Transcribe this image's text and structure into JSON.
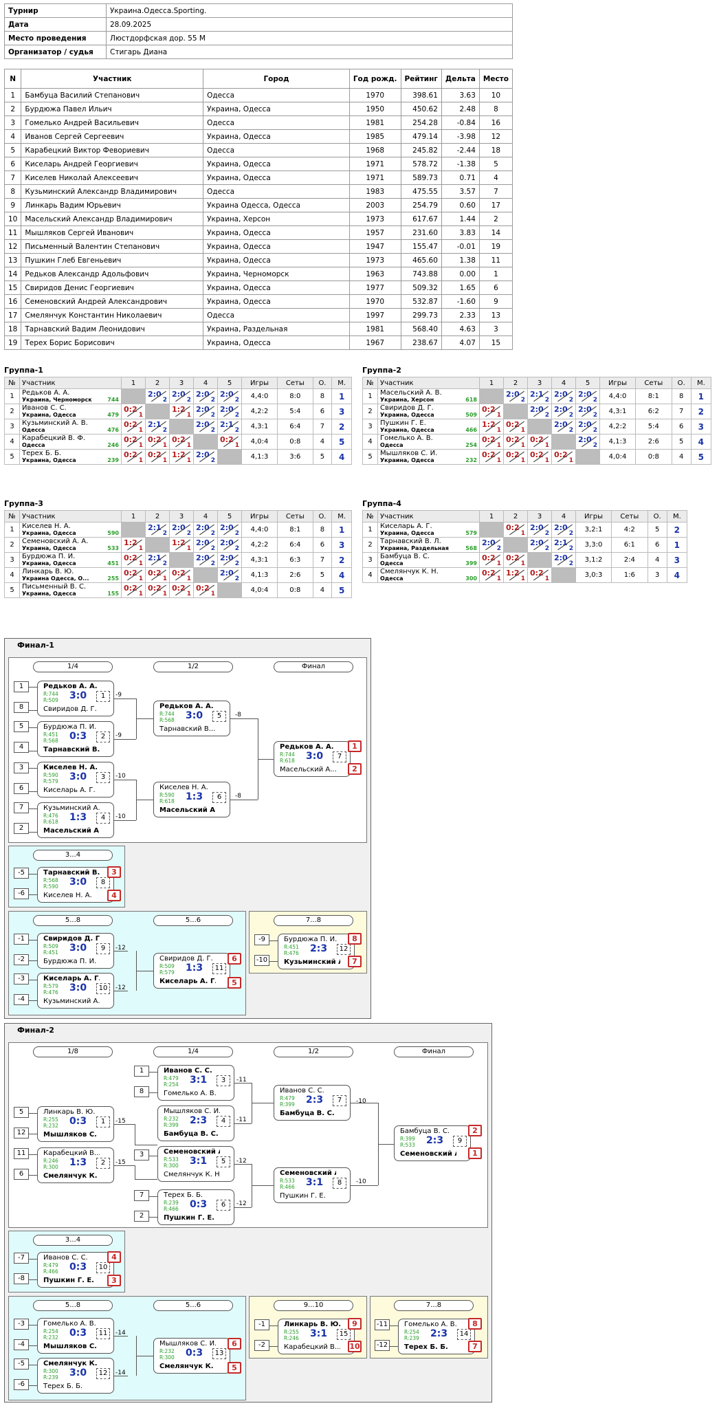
{
  "info": [
    {
      "k": "Турнир",
      "v": "Украина.Одесса.Sporting."
    },
    {
      "k": "Дата",
      "v": "28.09.2025"
    },
    {
      "k": "Место проведения",
      "v": "Люстдорфская дор. 55 М"
    },
    {
      "k": "Организатор / судья",
      "v": "Стигарь Диана"
    }
  ],
  "participants": {
    "headers": [
      "N",
      "Участник",
      "Город",
      "Год рожд.",
      "Рейтинг",
      "Дельта",
      "Место"
    ],
    "rows": [
      [
        "1",
        "Бамбуца Василий Степанович",
        "Одесса",
        "1970",
        "398.61",
        "3.63",
        "10"
      ],
      [
        "2",
        "Бурдюжа Павел Ильич",
        "Украина, Одесса",
        "1950",
        "450.62",
        "2.48",
        "8"
      ],
      [
        "3",
        "Гомелько Андрей Васильевич",
        "Одесса",
        "1981",
        "254.28",
        "-0.84",
        "16"
      ],
      [
        "4",
        "Иванов Сергей Сергеевич",
        "Украина, Одесса",
        "1985",
        "479.14",
        "-3.98",
        "12"
      ],
      [
        "5",
        "Карабецкий Виктор Февориевич",
        "Одесса",
        "1968",
        "245.82",
        "-2.44",
        "18"
      ],
      [
        "6",
        "Киселарь Андрей Георгиевич",
        "Украина, Одесса",
        "1971",
        "578.72",
        "-1.38",
        "5"
      ],
      [
        "7",
        "Киселев Николай Алексеевич",
        "Украина, Одесса",
        "1971",
        "589.73",
        "0.71",
        "4"
      ],
      [
        "8",
        "Кузьминский Александр Владимирович",
        "Одесса",
        "1983",
        "475.55",
        "3.57",
        "7"
      ],
      [
        "9",
        "Линкарь Вадим Юрьевич",
        "Украина Одесса, Одесса",
        "2003",
        "254.79",
        "0.60",
        "17"
      ],
      [
        "10",
        "Масельский Александр Владимирович",
        "Украина, Херсон",
        "1973",
        "617.67",
        "1.44",
        "2"
      ],
      [
        "11",
        "Мышляков Сергей Иванович",
        "Украина, Одесса",
        "1957",
        "231.60",
        "3.83",
        "14"
      ],
      [
        "12",
        "Письменный Валентин Степанович",
        "Украина, Одесса",
        "1947",
        "155.47",
        "-0.01",
        "19"
      ],
      [
        "13",
        "Пушкин Глеб Евгеньевич",
        "Украина, Одесса",
        "1973",
        "465.60",
        "1.38",
        "11"
      ],
      [
        "14",
        "Редьков Александр Адольфович",
        "Украина, Черноморск",
        "1963",
        "743.88",
        "0.00",
        "1"
      ],
      [
        "15",
        "Свиридов Денис Георгиевич",
        "Украина, Одесса",
        "1977",
        "509.32",
        "1.65",
        "6"
      ],
      [
        "16",
        "Семеновский Андрей Александрович",
        "Украина, Одесса",
        "1970",
        "532.87",
        "-1.60",
        "9"
      ],
      [
        "17",
        "Смелянчук Константин Николаевич",
        "Одесса",
        "1997",
        "299.73",
        "2.33",
        "13"
      ],
      [
        "18",
        "Тарнавский Вадим Леонидович",
        "Украина, Раздельная",
        "1981",
        "568.40",
        "4.63",
        "3"
      ],
      [
        "19",
        "Терех Борис Борисович",
        "Украина, Одесса",
        "1967",
        "238.67",
        "4.07",
        "15"
      ]
    ]
  },
  "groups": [
    {
      "title": "Группа-1",
      "cols": [
        "№",
        "Участник",
        "1",
        "2",
        "3",
        "4",
        "5",
        "Игры",
        "Сеты",
        "О.",
        "М."
      ],
      "rows": [
        {
          "n": "1",
          "name": "Редьков А. А.",
          "city": "Украина, Черноморск",
          "rt": "744",
          "res": [
            "X",
            "2:0/2",
            "2:0/2",
            "2:0/2",
            "2:0/2"
          ],
          "g": "4,4:0",
          "s": "8:0",
          "o": "8",
          "m": "1"
        },
        {
          "n": "2",
          "name": "Иванов С. С.",
          "city": "Украина, Одесса",
          "rt": "479",
          "res": [
            "0:2/1",
            "X",
            "1:2/1",
            "2:0/2",
            "2:0/2"
          ],
          "g": "4,2:2",
          "s": "5:4",
          "o": "6",
          "m": "3"
        },
        {
          "n": "3",
          "name": "Кузьминский А. В.",
          "city": "Одесса",
          "rt": "476",
          "res": [
            "0:2/1",
            "2:1/2",
            "X",
            "2:0/2",
            "2:1/2"
          ],
          "g": "4,3:1",
          "s": "6:4",
          "o": "7",
          "m": "2"
        },
        {
          "n": "4",
          "name": "Карабецкий В. Ф.",
          "city": "Одесса",
          "rt": "246",
          "res": [
            "0:2/1",
            "0:2/1",
            "0:2/1",
            "X",
            "0:2/1"
          ],
          "g": "4,0:4",
          "s": "0:8",
          "o": "4",
          "m": "5"
        },
        {
          "n": "5",
          "name": "Терех Б. Б.",
          "city": "Украина, Одесса",
          "rt": "239",
          "res": [
            "0:2/1",
            "0:2/1",
            "1:2/1",
            "2:0/2",
            "X"
          ],
          "g": "4,1:3",
          "s": "3:6",
          "o": "5",
          "m": "4"
        }
      ]
    },
    {
      "title": "Группа-2",
      "cols": [
        "№",
        "Участник",
        "1",
        "2",
        "3",
        "4",
        "5",
        "Игры",
        "Сеты",
        "О.",
        "М."
      ],
      "rows": [
        {
          "n": "1",
          "name": "Масельский А. В.",
          "city": "Украина, Херсон",
          "rt": "618",
          "res": [
            "X",
            "2:0/2",
            "2:1/2",
            "2:0/2",
            "2:0/2"
          ],
          "g": "4,4:0",
          "s": "8:1",
          "o": "8",
          "m": "1"
        },
        {
          "n": "2",
          "name": "Свиридов Д. Г.",
          "city": "Украина, Одесса",
          "rt": "509",
          "res": [
            "0:2/1",
            "X",
            "2:0/2",
            "2:0/2",
            "2:0/2"
          ],
          "g": "4,3:1",
          "s": "6:2",
          "o": "7",
          "m": "2"
        },
        {
          "n": "3",
          "name": "Пушкин Г. Е.",
          "city": "Украина, Одесса",
          "rt": "466",
          "res": [
            "1:2/1",
            "0:2/1",
            "X",
            "2:0/2",
            "2:0/2"
          ],
          "g": "4,2:2",
          "s": "5:4",
          "o": "6",
          "m": "3"
        },
        {
          "n": "4",
          "name": "Гомелько А. В.",
          "city": "Одесса",
          "rt": "254",
          "res": [
            "0:2/1",
            "0:2/1",
            "0:2/1",
            "X",
            "2:0/2"
          ],
          "g": "4,1:3",
          "s": "2:6",
          "o": "5",
          "m": "4"
        },
        {
          "n": "5",
          "name": "Мышляков С. И.",
          "city": "Украина, Одесса",
          "rt": "232",
          "res": [
            "0:2/1",
            "0:2/1",
            "0:2/1",
            "0:2/1",
            "X"
          ],
          "g": "4,0:4",
          "s": "0:8",
          "o": "4",
          "m": "5"
        }
      ]
    },
    {
      "title": "Группа-3",
      "cols": [
        "№",
        "Участник",
        "1",
        "2",
        "3",
        "4",
        "5",
        "Игры",
        "Сеты",
        "О.",
        "М."
      ],
      "rows": [
        {
          "n": "1",
          "name": "Киселев Н. А.",
          "city": "Украина, Одесса",
          "rt": "590",
          "res": [
            "X",
            "2:1/2",
            "2:0/2",
            "2:0/2",
            "2:0/2"
          ],
          "g": "4,4:0",
          "s": "8:1",
          "o": "8",
          "m": "1"
        },
        {
          "n": "2",
          "name": "Семеновский А. А.",
          "city": "Украина, Одесса",
          "rt": "533",
          "res": [
            "1:2/1",
            "X",
            "1:2/1",
            "2:0/2",
            "2:0/2"
          ],
          "g": "4,2:2",
          "s": "6:4",
          "o": "6",
          "m": "3"
        },
        {
          "n": "3",
          "name": "Бурдюжа П. И.",
          "city": "Украина, Одесса",
          "rt": "451",
          "res": [
            "0:2/1",
            "2:1/2",
            "X",
            "2:0/2",
            "2:0/2"
          ],
          "g": "4,3:1",
          "s": "6:3",
          "o": "7",
          "m": "2"
        },
        {
          "n": "4",
          "name": "Линкарь В. Ю.",
          "city": "Украина Одесса, О...",
          "rt": "255",
          "res": [
            "0:2/1",
            "0:2/1",
            "0:2/1",
            "X",
            "2:0/2"
          ],
          "g": "4,1:3",
          "s": "2:6",
          "o": "5",
          "m": "4"
        },
        {
          "n": "5",
          "name": "Письменный В. С.",
          "city": "Украина, Одесса",
          "rt": "155",
          "res": [
            "0:2/1",
            "0:2/1",
            "0:2/1",
            "0:2/1",
            "X"
          ],
          "g": "4,0:4",
          "s": "0:8",
          "o": "4",
          "m": "5"
        }
      ]
    },
    {
      "title": "Группа-4",
      "cols": [
        "№",
        "Участник",
        "1",
        "2",
        "3",
        "4",
        "Игры",
        "Сеты",
        "О.",
        "М."
      ],
      "rows": [
        {
          "n": "1",
          "name": "Киселарь А. Г.",
          "city": "Украина, Одесса",
          "rt": "579",
          "res": [
            "X",
            "0:2/1",
            "2:0/2",
            "2:0/2"
          ],
          "g": "3,2:1",
          "s": "4:2",
          "o": "5",
          "m": "2"
        },
        {
          "n": "2",
          "name": "Тарнавский В. Л.",
          "city": "Украина, Раздельная",
          "rt": "568",
          "res": [
            "2:0/2",
            "X",
            "2:0/2",
            "2:1/2"
          ],
          "g": "3,3:0",
          "s": "6:1",
          "o": "6",
          "m": "1"
        },
        {
          "n": "3",
          "name": "Бамбуца В. С.",
          "city": "Одесса",
          "rt": "399",
          "res": [
            "0:2/1",
            "0:2/1",
            "X",
            "2:0/2"
          ],
          "g": "3,1:2",
          "s": "2:4",
          "o": "4",
          "m": "3"
        },
        {
          "n": "4",
          "name": "Смелянчук К. Н.",
          "city": "Одесса",
          "rt": "300",
          "res": [
            "0:2/1",
            "1:2/1",
            "0:2/1",
            "X"
          ],
          "g": "3,0:3",
          "s": "1:6",
          "o": "3",
          "m": "4"
        }
      ]
    }
  ],
  "final1": {
    "title": "Финал-1",
    "headers": [
      "1/4",
      "1/2",
      "Финал",
      "3...4",
      "5...8",
      "5...6",
      "7...8"
    ],
    "seeds": [
      "1",
      "8",
      "5",
      "4",
      "3",
      "6",
      "7",
      "2",
      "-5",
      "-6",
      "-1",
      "-2",
      "-3",
      "-4",
      "-9",
      "-10"
    ],
    "matches": [
      {
        "p1": "Редьков А. А.",
        "p2": "Свиридов Д. Г.",
        "r1": "R:744",
        "r2": "R:509",
        "s": "3:0",
        "g": "1",
        "w": 1
      },
      {
        "p1": "Бурдюжа П. И.",
        "p2": "Тарнавский В....",
        "r1": "R:451",
        "r2": "R:568",
        "s": "0:3",
        "g": "2",
        "w": 2
      },
      {
        "p1": "Киселев Н. А.",
        "p2": "Киселарь А. Г.",
        "r1": "R:590",
        "r2": "R:579",
        "s": "3:0",
        "g": "3",
        "w": 1
      },
      {
        "p1": "Кузьминский А....",
        "p2": "Масельский А....",
        "r1": "R:476",
        "r2": "R:618",
        "s": "1:3",
        "g": "4",
        "w": 2
      },
      {
        "p1": "Редьков А. А.",
        "p2": "Тарнавский В....",
        "r1": "R:744",
        "r2": "R:568",
        "s": "3:0",
        "g": "5",
        "w": 1
      },
      {
        "p1": "Киселев Н. А.",
        "p2": "Масельский А....",
        "r1": "R:590",
        "r2": "R:618",
        "s": "1:3",
        "g": "6",
        "w": 2
      },
      {
        "p1": "Редьков А. А.",
        "p2": "Масельский А....",
        "r1": "R:744",
        "r2": "R:618",
        "s": "3:0",
        "g": "7",
        "w": 1
      },
      {
        "p1": "Тарнавский В....",
        "p2": "Киселев Н. А.",
        "r1": "R:568",
        "r2": "R:590",
        "s": "3:0",
        "g": "8",
        "w": 1
      },
      {
        "p1": "Свиридов Д. Г.",
        "p2": "Бурдюжа П. И.",
        "r1": "R:509",
        "r2": "R:451",
        "s": "3:0",
        "g": "9",
        "w": 1
      },
      {
        "p1": "Киселарь А. Г.",
        "p2": "Кузьминский А....",
        "r1": "R:579",
        "r2": "R:476",
        "s": "3:0",
        "g": "10",
        "w": 1
      },
      {
        "p1": "Свиридов Д. Г.",
        "p2": "Киселарь А. Г.",
        "r1": "R:509",
        "r2": "R:579",
        "s": "1:3",
        "g": "11",
        "w": 2
      },
      {
        "p1": "Бурдюжа П. И.",
        "p2": "Кузьминский А....",
        "r1": "R:451",
        "r2": "R:476",
        "s": "2:3",
        "g": "12",
        "w": 2
      }
    ],
    "places": [
      "1",
      "2",
      "3",
      "4",
      "6",
      "5",
      "8",
      "7"
    ],
    "notes": [
      "-9",
      "-9",
      "-10",
      "-10",
      "-8",
      "-8",
      "-12",
      "-12"
    ]
  },
  "final2": {
    "title": "Финал-2",
    "headers": [
      "1/8",
      "1/4",
      "1/2",
      "Финал",
      "3...4",
      "5...8",
      "5...6",
      "9...10",
      "7...8"
    ],
    "seeds": [
      "1",
      "8",
      "5",
      "12",
      "11",
      "6",
      "3",
      "7",
      "2",
      "-7",
      "-8",
      "-3",
      "-4",
      "-5",
      "-6",
      "-1",
      "-2",
      "-11",
      "-12"
    ],
    "matches": [
      {
        "p1": "Иванов С. С.",
        "p2": "Гомелько А. В.",
        "r1": "R:479",
        "r2": "R:254",
        "s": "3:1",
        "g": "3",
        "w": 1
      },
      {
        "p1": "Линкарь В. Ю.",
        "p2": "Мышляков С. И.",
        "r1": "R:255",
        "r2": "R:232",
        "s": "0:3",
        "g": "1",
        "w": 2
      },
      {
        "p1": "Мышляков С. И.",
        "p2": "Бамбуца В. С.",
        "r1": "R:232",
        "r2": "R:399",
        "s": "2:3",
        "g": "4",
        "w": 2
      },
      {
        "p1": "Карабецкий В....",
        "p2": "Смелянчук К. Н.",
        "r1": "R:246",
        "r2": "R:300",
        "s": "1:3",
        "g": "2",
        "w": 2
      },
      {
        "p1": "Семеновский А....",
        "p2": "Смелянчук К. Н.",
        "r1": "R:533",
        "r2": "R:300",
        "s": "3:1",
        "g": "5",
        "w": 1
      },
      {
        "p1": "Терех Б. Б.",
        "p2": "Пушкин Г. Е.",
        "r1": "R:239",
        "r2": "R:466",
        "s": "0:3",
        "g": "6",
        "w": 2
      },
      {
        "p1": "Иванов С. С.",
        "p2": "Бамбуца В. С.",
        "r1": "R:479",
        "r2": "R:399",
        "s": "2:3",
        "g": "7",
        "w": 2
      },
      {
        "p1": "Семеновский А....",
        "p2": "Пушкин Г. Е.",
        "r1": "R:533",
        "r2": "R:466",
        "s": "3:1",
        "g": "8",
        "w": 1
      },
      {
        "p1": "Бамбуца В. С.",
        "p2": "Семеновский А....",
        "r1": "R:399",
        "r2": "R:533",
        "s": "2:3",
        "g": "9",
        "w": 2
      },
      {
        "p1": "Иванов С. С.",
        "p2": "Пушкин Г. Е.",
        "r1": "R:479",
        "r2": "R:466",
        "s": "0:3",
        "g": "10",
        "w": 2
      },
      {
        "p1": "Гомелько А. В.",
        "p2": "Мышляков С. И.",
        "r1": "R:254",
        "r2": "R:232",
        "s": "0:3",
        "g": "11",
        "w": 2
      },
      {
        "p1": "Смелянчук К. Н.",
        "p2": "Терех Б. Б.",
        "r1": "R:300",
        "r2": "R:239",
        "s": "3:0",
        "g": "12",
        "w": 1
      },
      {
        "p1": "Мышляков С. И.",
        "p2": "Смелянчук К. Н.",
        "r1": "R:232",
        "r2": "R:300",
        "s": "0:3",
        "g": "13",
        "w": 2
      },
      {
        "p1": "Линкарь В. Ю.",
        "p2": "Карабецкий В....",
        "r1": "R:255",
        "r2": "R:246",
        "s": "3:1",
        "g": "15",
        "w": 1
      },
      {
        "p1": "Гомелько А. В.",
        "p2": "Терех Б. Б.",
        "r1": "R:254",
        "r2": "R:239",
        "s": "2:3",
        "g": "14",
        "w": 2
      }
    ],
    "places": [
      "2",
      "1",
      "4",
      "3",
      "6",
      "5",
      "9",
      "10",
      "8",
      "7"
    ],
    "notes": [
      "-15",
      "-15",
      "-11",
      "-11",
      "-12",
      "-12",
      "-10",
      "-10",
      "-14",
      "-14"
    ]
  }
}
